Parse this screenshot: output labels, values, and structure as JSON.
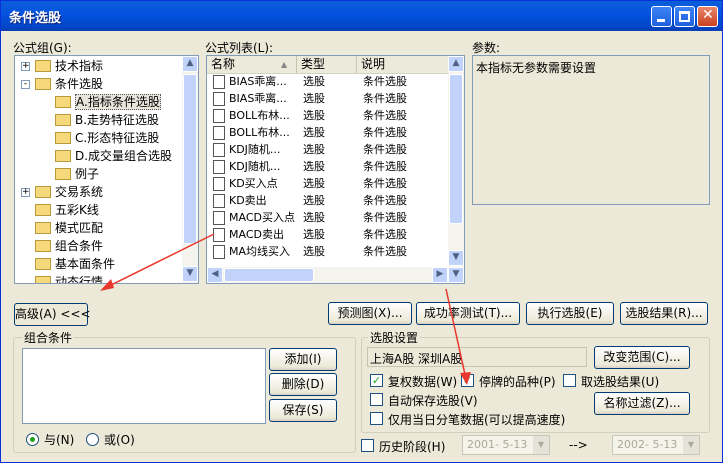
{
  "window": {
    "title": "条件选股"
  },
  "formula_group": {
    "label": "公式组(G):",
    "items": [
      {
        "label": "技术指标",
        "level": 0,
        "expander": "+"
      },
      {
        "label": "条件选股",
        "level": 0,
        "expander": "-"
      },
      {
        "label": "A.指标条件选股",
        "level": 1,
        "selected": true
      },
      {
        "label": "B.走势特征选股",
        "level": 1
      },
      {
        "label": "C.形态特征选股",
        "level": 1
      },
      {
        "label": "D.成交量组合选股",
        "level": 1
      },
      {
        "label": "例子",
        "level": 1
      },
      {
        "label": "交易系统",
        "level": 0,
        "expander": "+"
      },
      {
        "label": "五彩K线",
        "level": 0
      },
      {
        "label": "模式匹配",
        "level": 0
      },
      {
        "label": "组合条件",
        "level": 0
      },
      {
        "label": "基本面条件",
        "level": 0
      },
      {
        "label": "动态行情",
        "level": 0
      }
    ]
  },
  "formula_list": {
    "label": "公式列表(L):",
    "columns": [
      "名称",
      "类型",
      "说明"
    ],
    "rows": [
      [
        "BIAS乖离...",
        "选股",
        "条件选股"
      ],
      [
        "BIAS乖离...",
        "选股",
        "条件选股"
      ],
      [
        "BOLL布林...",
        "选股",
        "条件选股"
      ],
      [
        "BOLL布林...",
        "选股",
        "条件选股"
      ],
      [
        "KDJ随机...",
        "选股",
        "条件选股"
      ],
      [
        "KDJ随机...",
        "选股",
        "条件选股"
      ],
      [
        "KD买入点",
        "选股",
        "条件选股"
      ],
      [
        "KD卖出",
        "选股",
        "条件选股"
      ],
      [
        "MACD买入点",
        "选股",
        "条件选股"
      ],
      [
        "MACD卖出",
        "选股",
        "条件选股"
      ],
      [
        "MA均线买入",
        "选股",
        "条件选股"
      ]
    ]
  },
  "params": {
    "label": "参数:",
    "text": "本指标无参数需要设置"
  },
  "buttons": {
    "advanced": "高级(A) <<<",
    "preview": "预测图(X)...",
    "success_rate": "成功率测试(T)...",
    "execute": "执行选股(E)",
    "result": "选股结果(R)...",
    "add": "添加(I)",
    "delete": "删除(D)",
    "save": "保存(S)",
    "change_range": "改变范围(C)...",
    "name_filter": "名称过滤(Z)..."
  },
  "combo_conditions": {
    "label": "组合条件",
    "radio_and": "与(N)",
    "radio_or": "或(O)",
    "selected": "与(N)"
  },
  "stock_settings": {
    "label": "选股设置",
    "range": "上海A股  深圳A股",
    "options": [
      {
        "label": "复权数据(W)",
        "checked": true
      },
      {
        "label": "停牌的品种(P)",
        "checked": true
      },
      {
        "label": "取选股结果(U)",
        "checked": false
      },
      {
        "label": "自动保存选股(V)",
        "checked": false
      },
      {
        "label": "仅用当日分笔数据(可以提高速度)",
        "checked": false
      }
    ],
    "history": {
      "label": "历史阶段(H)",
      "checked": false,
      "from": "2001- 5-13",
      "arrow": "-->",
      "to": "2002- 5-13"
    }
  },
  "colors": {
    "title_bar": "#0054e3",
    "selection": "#0a246a",
    "annotation_arrow": "#e8372c"
  }
}
